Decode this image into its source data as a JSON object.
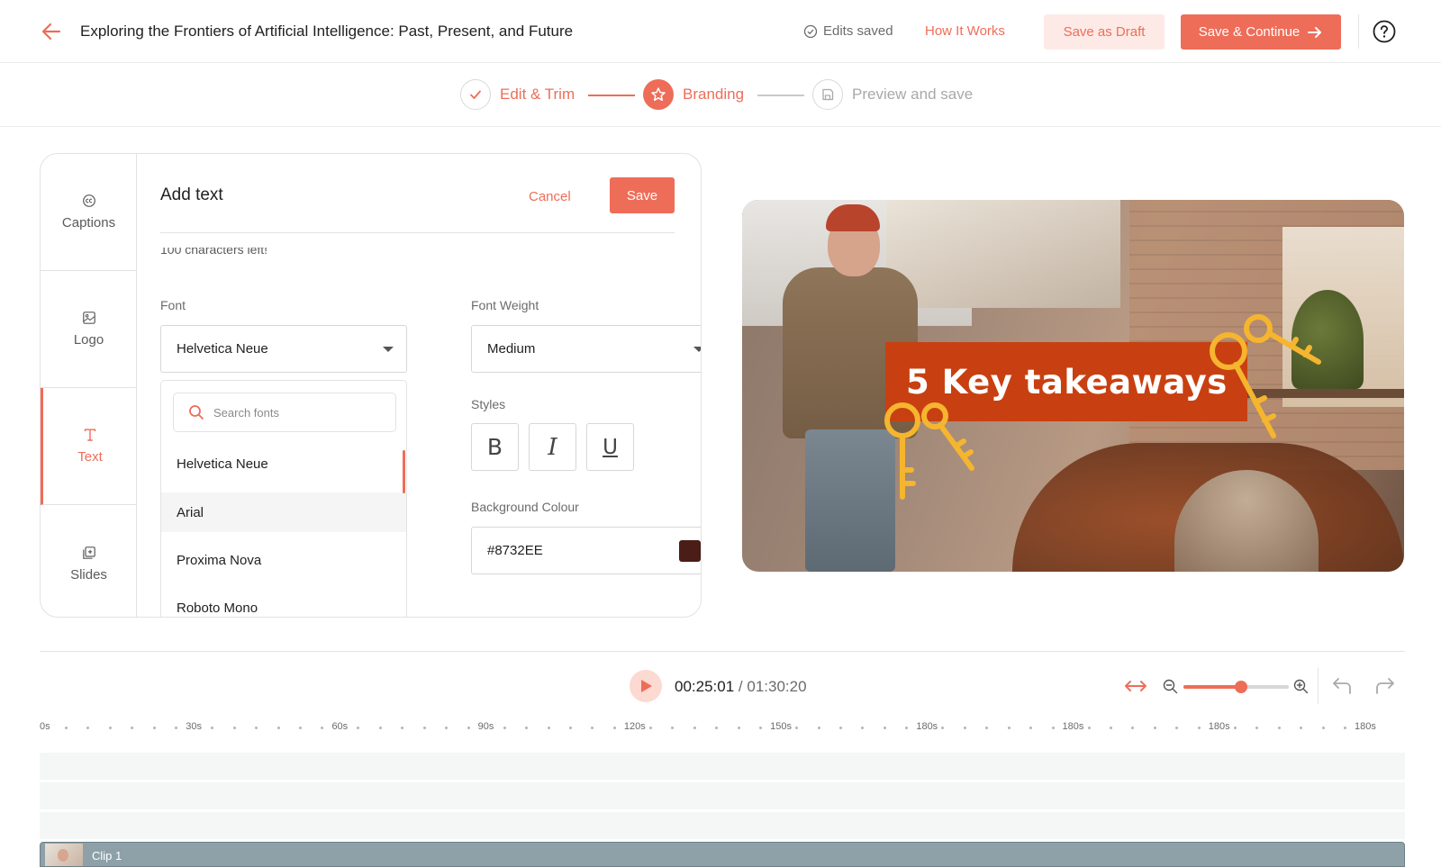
{
  "header": {
    "title": "Exploring the Frontiers of Artificial Intelligence: Past, Present, and Future",
    "edits_status": "Edits saved",
    "how_it_works": "How It Works",
    "save_draft": "Save as Draft",
    "save_continue": "Save & Continue"
  },
  "stepper": {
    "steps": [
      {
        "label": "Edit & Trim",
        "state": "done"
      },
      {
        "label": "Branding",
        "state": "active"
      },
      {
        "label": "Preview and save",
        "state": "pending"
      }
    ]
  },
  "sidebar": {
    "items": [
      {
        "label": "Captions",
        "icon": "cc-icon"
      },
      {
        "label": "Logo",
        "icon": "image-icon"
      },
      {
        "label": "Text",
        "icon": "text-icon",
        "active": true
      },
      {
        "label": "Slides",
        "icon": "slides-icon"
      }
    ]
  },
  "editor": {
    "title": "Add text",
    "cancel": "Cancel",
    "save": "Save",
    "chars_left": "100 characters left!",
    "font_label": "Font",
    "font_value": "Helvetica Neue",
    "weight_label": "Font Weight",
    "weight_value": "Medium",
    "search_placeholder": "Search fonts",
    "font_options": [
      "Helvetica Neue",
      "Arial",
      "Proxima Nova",
      "Roboto Mono"
    ],
    "styles_label": "Styles",
    "styles": [
      "B",
      "I",
      "U"
    ],
    "bg_label": "Background Colour",
    "bg_value": "#8732EE",
    "bg_swatch_color": "#4a1d16"
  },
  "preview": {
    "overlay_text": "5 Key takeaways",
    "banner_color": "#c84011",
    "key_color": "#f5b52e"
  },
  "timeline": {
    "current_time": "00:25:01",
    "separator": " / ",
    "total_time": "01:30:20",
    "zoom_fraction": 0.55,
    "ruler": [
      "0s",
      "30s",
      "60s",
      "90s",
      "120s",
      "150s",
      "180s",
      "180s",
      "180s",
      "180s"
    ],
    "clip_label": "Clip 1"
  },
  "colors": {
    "accent": "#ee6d58",
    "accent_light": "#fdeae6"
  }
}
